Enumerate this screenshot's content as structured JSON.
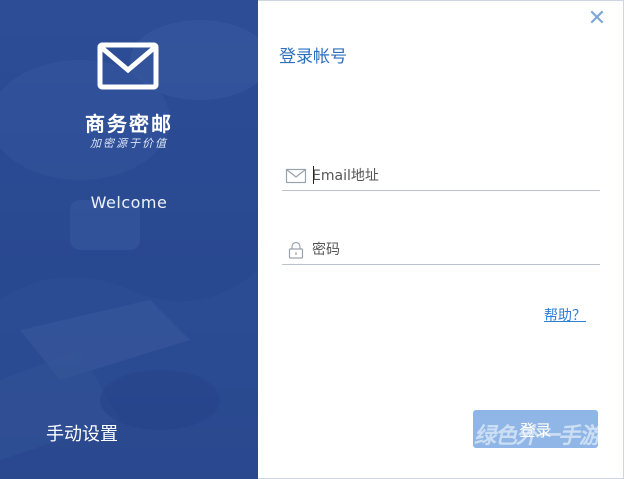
{
  "window": {
    "close_glyph": "✕"
  },
  "left_panel": {
    "brand_name": "商务密邮",
    "slogan": "加密源于价值",
    "welcome": "Welcome",
    "manual_settings": "手动设置",
    "logo_icon": "envelope-icon",
    "background_color": "#2c4a8e"
  },
  "form": {
    "title": "登录帐号",
    "email": {
      "placeholder": "Email地址",
      "value": "",
      "icon": "envelope-outline-icon"
    },
    "password": {
      "placeholder": "密码",
      "value": "",
      "icon": "lock-icon"
    },
    "help_link": "帮助？",
    "login_button": "登录",
    "accent_color": "#2d6fbd",
    "button_color": "#8fb6e6"
  },
  "watermark": "绿色外一手游"
}
